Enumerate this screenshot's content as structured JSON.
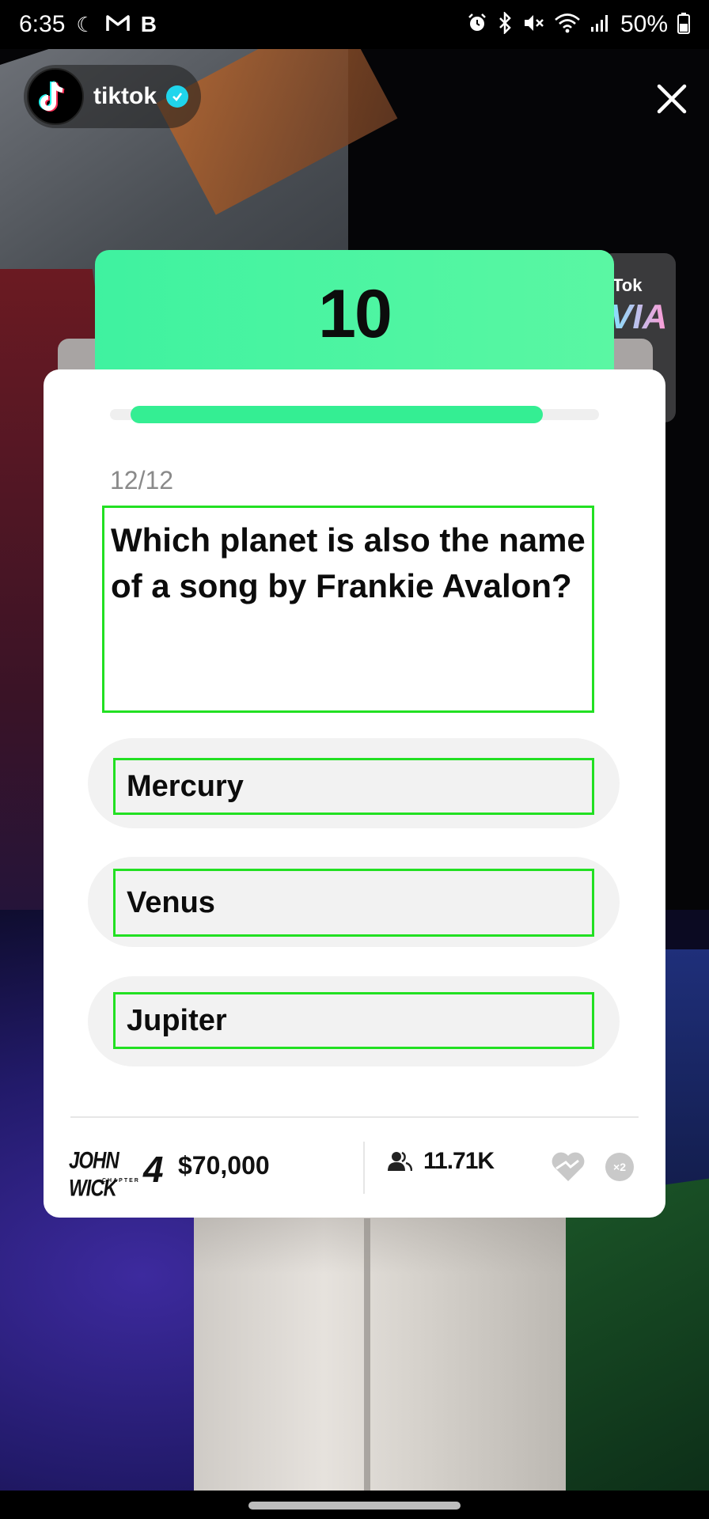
{
  "status_bar": {
    "time": "6:35",
    "battery": "50%",
    "left_icons": [
      "moon-icon",
      "gmail-icon",
      "b-icon"
    ],
    "right_icons": [
      "alarm-icon",
      "bluetooth-icon",
      "mute-icon",
      "wifi-icon",
      "signal-icon",
      "battery-icon"
    ]
  },
  "header": {
    "account_name": "tiktok",
    "verified": true
  },
  "peek_card": {
    "label_1": "Tok",
    "label_2": "VIA"
  },
  "quiz": {
    "timer": "10",
    "progress_fraction": 0.92,
    "counter": "12/12",
    "question": "Which planet is also the name of a song by Frankie Avalon?",
    "options": [
      {
        "label": "Mercury"
      },
      {
        "label": "Venus"
      },
      {
        "label": "Jupiter"
      }
    ]
  },
  "footer": {
    "sponsor_text": "JOHN WICK",
    "sponsor_number": "4",
    "sponsor_sub": "CHAPTER",
    "prize": "$70,000",
    "players": "11.71K",
    "multiplier": "×2"
  },
  "colors": {
    "accent_green": "#34ee93",
    "outline_green": "#22e022",
    "verified_blue": "#20d5ec"
  }
}
